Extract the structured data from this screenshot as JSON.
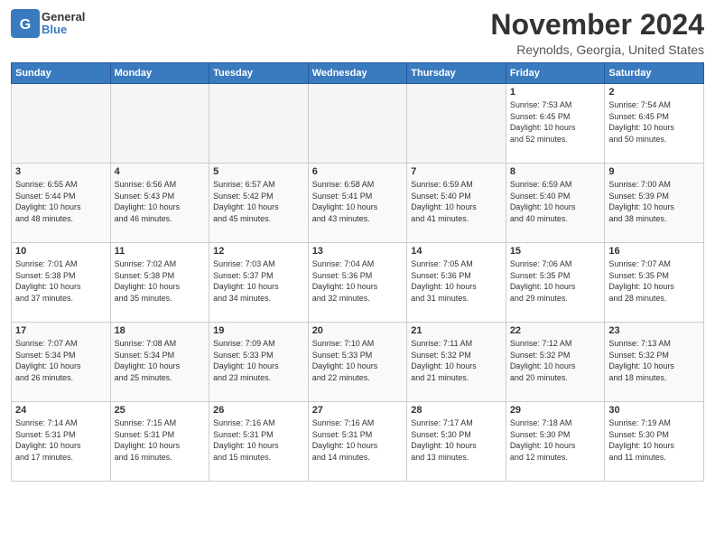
{
  "header": {
    "logo_general": "General",
    "logo_blue": "Blue",
    "month_year": "November 2024",
    "location": "Reynolds, Georgia, United States"
  },
  "days_of_week": [
    "Sunday",
    "Monday",
    "Tuesday",
    "Wednesday",
    "Thursday",
    "Friday",
    "Saturday"
  ],
  "weeks": [
    [
      {
        "day": "",
        "info": ""
      },
      {
        "day": "",
        "info": ""
      },
      {
        "day": "",
        "info": ""
      },
      {
        "day": "",
        "info": ""
      },
      {
        "day": "",
        "info": ""
      },
      {
        "day": "1",
        "info": "Sunrise: 7:53 AM\nSunset: 6:45 PM\nDaylight: 10 hours\nand 52 minutes."
      },
      {
        "day": "2",
        "info": "Sunrise: 7:54 AM\nSunset: 6:45 PM\nDaylight: 10 hours\nand 50 minutes."
      }
    ],
    [
      {
        "day": "3",
        "info": "Sunrise: 6:55 AM\nSunset: 5:44 PM\nDaylight: 10 hours\nand 48 minutes."
      },
      {
        "day": "4",
        "info": "Sunrise: 6:56 AM\nSunset: 5:43 PM\nDaylight: 10 hours\nand 46 minutes."
      },
      {
        "day": "5",
        "info": "Sunrise: 6:57 AM\nSunset: 5:42 PM\nDaylight: 10 hours\nand 45 minutes."
      },
      {
        "day": "6",
        "info": "Sunrise: 6:58 AM\nSunset: 5:41 PM\nDaylight: 10 hours\nand 43 minutes."
      },
      {
        "day": "7",
        "info": "Sunrise: 6:59 AM\nSunset: 5:40 PM\nDaylight: 10 hours\nand 41 minutes."
      },
      {
        "day": "8",
        "info": "Sunrise: 6:59 AM\nSunset: 5:40 PM\nDaylight: 10 hours\nand 40 minutes."
      },
      {
        "day": "9",
        "info": "Sunrise: 7:00 AM\nSunset: 5:39 PM\nDaylight: 10 hours\nand 38 minutes."
      }
    ],
    [
      {
        "day": "10",
        "info": "Sunrise: 7:01 AM\nSunset: 5:38 PM\nDaylight: 10 hours\nand 37 minutes."
      },
      {
        "day": "11",
        "info": "Sunrise: 7:02 AM\nSunset: 5:38 PM\nDaylight: 10 hours\nand 35 minutes."
      },
      {
        "day": "12",
        "info": "Sunrise: 7:03 AM\nSunset: 5:37 PM\nDaylight: 10 hours\nand 34 minutes."
      },
      {
        "day": "13",
        "info": "Sunrise: 7:04 AM\nSunset: 5:36 PM\nDaylight: 10 hours\nand 32 minutes."
      },
      {
        "day": "14",
        "info": "Sunrise: 7:05 AM\nSunset: 5:36 PM\nDaylight: 10 hours\nand 31 minutes."
      },
      {
        "day": "15",
        "info": "Sunrise: 7:06 AM\nSunset: 5:35 PM\nDaylight: 10 hours\nand 29 minutes."
      },
      {
        "day": "16",
        "info": "Sunrise: 7:07 AM\nSunset: 5:35 PM\nDaylight: 10 hours\nand 28 minutes."
      }
    ],
    [
      {
        "day": "17",
        "info": "Sunrise: 7:07 AM\nSunset: 5:34 PM\nDaylight: 10 hours\nand 26 minutes."
      },
      {
        "day": "18",
        "info": "Sunrise: 7:08 AM\nSunset: 5:34 PM\nDaylight: 10 hours\nand 25 minutes."
      },
      {
        "day": "19",
        "info": "Sunrise: 7:09 AM\nSunset: 5:33 PM\nDaylight: 10 hours\nand 23 minutes."
      },
      {
        "day": "20",
        "info": "Sunrise: 7:10 AM\nSunset: 5:33 PM\nDaylight: 10 hours\nand 22 minutes."
      },
      {
        "day": "21",
        "info": "Sunrise: 7:11 AM\nSunset: 5:32 PM\nDaylight: 10 hours\nand 21 minutes."
      },
      {
        "day": "22",
        "info": "Sunrise: 7:12 AM\nSunset: 5:32 PM\nDaylight: 10 hours\nand 20 minutes."
      },
      {
        "day": "23",
        "info": "Sunrise: 7:13 AM\nSunset: 5:32 PM\nDaylight: 10 hours\nand 18 minutes."
      }
    ],
    [
      {
        "day": "24",
        "info": "Sunrise: 7:14 AM\nSunset: 5:31 PM\nDaylight: 10 hours\nand 17 minutes."
      },
      {
        "day": "25",
        "info": "Sunrise: 7:15 AM\nSunset: 5:31 PM\nDaylight: 10 hours\nand 16 minutes."
      },
      {
        "day": "26",
        "info": "Sunrise: 7:16 AM\nSunset: 5:31 PM\nDaylight: 10 hours\nand 15 minutes."
      },
      {
        "day": "27",
        "info": "Sunrise: 7:16 AM\nSunset: 5:31 PM\nDaylight: 10 hours\nand 14 minutes."
      },
      {
        "day": "28",
        "info": "Sunrise: 7:17 AM\nSunset: 5:30 PM\nDaylight: 10 hours\nand 13 minutes."
      },
      {
        "day": "29",
        "info": "Sunrise: 7:18 AM\nSunset: 5:30 PM\nDaylight: 10 hours\nand 12 minutes."
      },
      {
        "day": "30",
        "info": "Sunrise: 7:19 AM\nSunset: 5:30 PM\nDaylight: 10 hours\nand 11 minutes."
      }
    ]
  ]
}
